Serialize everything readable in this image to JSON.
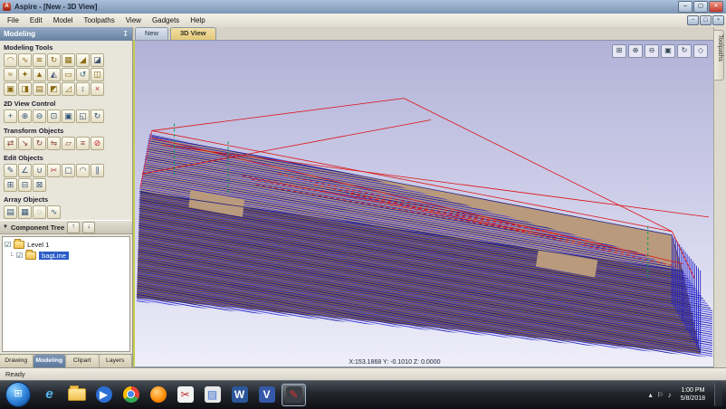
{
  "window": {
    "title": "Aspire - [New - 3D View]",
    "app_icon_glyph": "A",
    "minimize_glyph": "–",
    "restore_glyph": "▢",
    "close_glyph": "×"
  },
  "menubar": {
    "items": [
      "File",
      "Edit",
      "Model",
      "Toolpaths",
      "View",
      "Gadgets",
      "Help"
    ]
  },
  "sidebar": {
    "title": "Modeling",
    "pin_glyph": "↧",
    "sections": [
      {
        "label": "Modeling Tools",
        "icons": [
          {
            "name": "create-shape-icon",
            "glyph": "◠",
            "color": "#8a6a10"
          },
          {
            "name": "two-rail-sweep-icon",
            "glyph": "∿",
            "color": "#8a6a10"
          },
          {
            "name": "extrude-weave-icon",
            "glyph": "≋",
            "color": "#8a6a10"
          },
          {
            "name": "turn-spin-icon",
            "glyph": "↻",
            "color": "#8a6a10"
          },
          {
            "name": "texture-area-icon",
            "glyph": "▦",
            "color": "#8a6a10"
          },
          {
            "name": "add-draft-icon",
            "glyph": "◢",
            "color": "#8a6a10"
          },
          {
            "name": "import-component-icon",
            "glyph": "◪",
            "color": "#445577"
          },
          {
            "name": "smooth-model-icon",
            "glyph": "≈",
            "color": "#8a6a10"
          },
          {
            "name": "sculpt-icon",
            "glyph": "✦",
            "color": "#8a6a10"
          },
          {
            "name": "deposit-material-icon",
            "glyph": "▲",
            "color": "#8a6a10"
          },
          {
            "name": "carve-material-icon",
            "glyph": "◭",
            "color": "#445577"
          },
          {
            "name": "erase-model-icon",
            "glyph": "▭",
            "color": "#8a6a10"
          },
          {
            "name": "undo-model-icon",
            "glyph": "↺",
            "color": "#336688"
          },
          {
            "name": "mirror-model-icon",
            "glyph": "◫",
            "color": "#8a6a10"
          },
          {
            "name": "component-from-model-icon",
            "glyph": "▣",
            "color": "#8a6a10"
          },
          {
            "name": "split-components-icon",
            "glyph": "◨",
            "color": "#8a6a10"
          },
          {
            "name": "level-components-icon",
            "glyph": "▤",
            "color": "#8a6a10"
          },
          {
            "name": "fade-relief-icon",
            "glyph": "◩",
            "color": "#8a6a10"
          },
          {
            "name": "tilt-relief-icon",
            "glyph": "◿",
            "color": "#8a6a10"
          },
          {
            "name": "scale-height-icon",
            "glyph": "↕",
            "color": "#336688"
          },
          {
            "name": "delete-component-icon",
            "glyph": "×",
            "color": "#aa3333"
          }
        ]
      },
      {
        "label": "2D View Control",
        "icons": [
          {
            "name": "pan-view-icon",
            "glyph": "+",
            "color": "#335577"
          },
          {
            "name": "zoom-in-icon",
            "glyph": "⊕",
            "color": "#335577"
          },
          {
            "name": "zoom-out-icon",
            "glyph": "⊖",
            "color": "#335577"
          },
          {
            "name": "zoom-box-icon",
            "glyph": "⊡",
            "color": "#335577"
          },
          {
            "name": "zoom-extents-icon",
            "glyph": "▣",
            "color": "#335577"
          },
          {
            "name": "zoom-selected-icon",
            "glyph": "◱",
            "color": "#335577"
          },
          {
            "name": "refresh-2d-view-icon",
            "glyph": "↻",
            "color": "#335577"
          }
        ]
      },
      {
        "label": "Transform Objects",
        "icons": [
          {
            "name": "move-selection-icon",
            "glyph": "⇄",
            "color": "#884433"
          },
          {
            "name": "set-size-icon",
            "glyph": "↘",
            "color": "#884433"
          },
          {
            "name": "rotate-selection-icon",
            "glyph": "↻",
            "color": "#884433"
          },
          {
            "name": "mirror-selection-icon",
            "glyph": "⇋",
            "color": "#884433"
          },
          {
            "name": "distort-object-icon",
            "glyph": "▱",
            "color": "#884433"
          },
          {
            "name": "align-objects-icon",
            "glyph": "≡",
            "color": "#884433"
          },
          {
            "name": "snapping-disabled-icon",
            "glyph": "⊘",
            "color": "#cc2222"
          }
        ]
      },
      {
        "label": "Edit Objects",
        "icons": [
          {
            "name": "node-edit-icon",
            "glyph": "✎",
            "color": "#335577"
          },
          {
            "name": "measure-icon",
            "glyph": "∠",
            "color": "#335577"
          },
          {
            "name": "join-vectors-icon",
            "glyph": "∪",
            "color": "#335577"
          },
          {
            "name": "cut-object-icon",
            "glyph": "✂",
            "color": "#aa3333"
          },
          {
            "name": "copy-object-icon",
            "glyph": "▢",
            "color": "#335577"
          },
          {
            "name": "fillet-icon",
            "glyph": "◠",
            "color": "#335577"
          },
          {
            "name": "offset-vectors-icon",
            "glyph": "∥",
            "color": "#335577"
          },
          {
            "name": "weld-vectors-icon",
            "glyph": "⊞",
            "color": "#335577"
          },
          {
            "name": "subtract-vectors-icon",
            "glyph": "⊟",
            "color": "#335577"
          },
          {
            "name": "intersect-vectors-icon",
            "glyph": "⊠",
            "color": "#335577"
          }
        ]
      },
      {
        "label": "Array Objects",
        "icons": [
          {
            "name": "linear-array-icon",
            "glyph": "▤",
            "color": "#335577"
          },
          {
            "name": "grid-array-icon",
            "glyph": "▦",
            "color": "#335577"
          },
          {
            "name": "circular-array-icon",
            "glyph": "◌",
            "color": "#335577"
          },
          {
            "name": "array-along-curve-icon",
            "glyph": "∿",
            "color": "#335577"
          }
        ]
      }
    ],
    "component_tree": {
      "title": "Component Tree",
      "expander_glyph": "▼",
      "up_glyph": "↑",
      "down_glyph": "↓",
      "checkbox_glyph": "☑",
      "items": [
        {
          "label": "Level 1"
        },
        {
          "label": "bagLine"
        }
      ]
    },
    "tabs": [
      "Drawing",
      "Modeling",
      "Clipart",
      "Layers"
    ]
  },
  "main": {
    "doc_tabs": [
      "New",
      "3D View"
    ],
    "right_tab": "Toolpaths",
    "view_toolbar": [
      {
        "name": "multi-window-icon",
        "glyph": "⊞"
      },
      {
        "name": "zoom-in-3d-icon",
        "glyph": "⊕"
      },
      {
        "name": "zoom-out-3d-icon",
        "glyph": "⊖"
      },
      {
        "name": "zoom-extents-3d-icon",
        "glyph": "▣"
      },
      {
        "name": "rotate-view-icon",
        "glyph": "↻"
      },
      {
        "name": "isometric-view-icon",
        "glyph": "◇"
      }
    ],
    "coords": "X:153.1868 Y: -0.1010 Z: 0.0000"
  },
  "scene": {
    "colors": {
      "wood_top": "#b99a7d",
      "wood_front": "#7f5f46",
      "wood_end": "#8f6b50",
      "toolpath_blue": "#2424c8",
      "rapid_red": "#dd1111",
      "marker_green": "#00a050"
    }
  },
  "statusbar": {
    "ready": "Ready"
  },
  "taskbar": {
    "apps": [
      {
        "name": "taskbar-internet-explorer",
        "glyph": "e",
        "fg": "#54b4ec",
        "shape": "text",
        "italic": true
      },
      {
        "name": "taskbar-explorer",
        "shape": "folder"
      },
      {
        "name": "taskbar-media-player",
        "glyph": "▶",
        "fg": "#ffffff",
        "bg": "#2a6fd4",
        "shape": "circle"
      },
      {
        "name": "taskbar-chrome",
        "shape": "chrome"
      },
      {
        "name": "taskbar-firefox",
        "glyph": "",
        "bg": "radial-gradient(circle at 40% 35%, #ffd27f, #ff8a00 60%, #d45500)",
        "shape": "circle"
      },
      {
        "name": "taskbar-snipping-tool",
        "glyph": "✂",
        "fg": "#c03030",
        "bg": "#f2f2f2",
        "shape": "text"
      },
      {
        "name": "taskbar-paint",
        "glyph": "▨",
        "fg": "#3a6fd0",
        "bg": "#e8e8e8",
        "shape": "text"
      },
      {
        "name": "taskbar-word",
        "glyph": "W",
        "fg": "#ffffff",
        "bg": "#2b579a",
        "shape": "text"
      },
      {
        "name": "taskbar-vcarve",
        "glyph": "V",
        "fg": "#ffffff",
        "bg": "#3558a8",
        "shape": "text"
      },
      {
        "name": "taskbar-aspire",
        "glyph": "✎",
        "fg": "#e03030",
        "bg": "#3a3f46",
        "shape": "text",
        "active": true
      }
    ],
    "tray": [
      {
        "name": "tray-expand-icon",
        "glyph": "▴"
      },
      {
        "name": "tray-flag-icon",
        "glyph": "⚐"
      },
      {
        "name": "tray-volume-icon",
        "glyph": "♪"
      }
    ],
    "time": "1:00 PM",
    "date": "5/8/2018"
  }
}
